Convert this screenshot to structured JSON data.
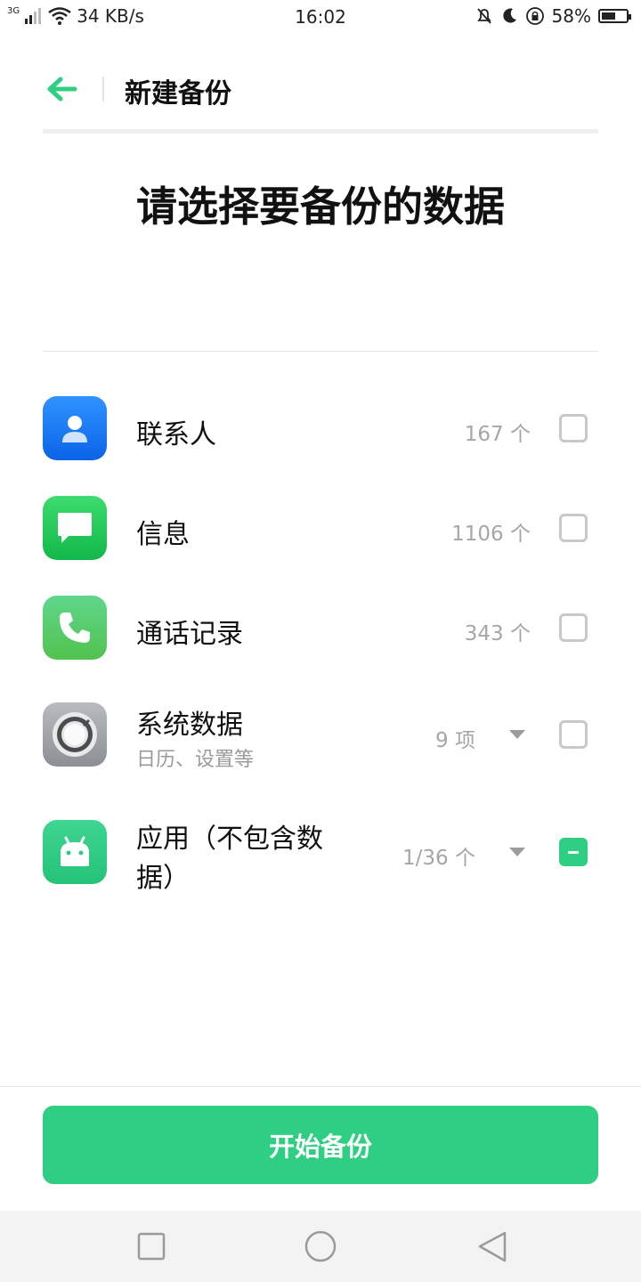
{
  "status_bar": {
    "network": "3G",
    "speed": "34 KB/s",
    "time": "16:02",
    "battery": "58%",
    "battery_level": 0.58
  },
  "header": {
    "title": "新建备份"
  },
  "page_title": "请选择要备份的数据",
  "items": [
    {
      "label": "联系人",
      "sub": "",
      "count": "167 个",
      "has_arrow": false,
      "state": "unchecked",
      "icon": "contact-icon"
    },
    {
      "label": "信息",
      "sub": "",
      "count": "1106 个",
      "has_arrow": false,
      "state": "unchecked",
      "icon": "message-icon"
    },
    {
      "label": "通话记录",
      "sub": "",
      "count": "343 个",
      "has_arrow": false,
      "state": "unchecked",
      "icon": "phone-icon"
    },
    {
      "label": "系统数据",
      "sub": "日历、设置等",
      "count": "9 项",
      "has_arrow": true,
      "state": "unchecked",
      "icon": "settings-icon"
    },
    {
      "label": "应用（不包含数",
      "label2": "据）",
      "sub": "",
      "count": "1/36 个",
      "has_arrow": true,
      "state": "partial",
      "icon": "android-icon"
    }
  ],
  "start_button": "开始备份",
  "colors": {
    "accent": "#2ecf82",
    "contact_icon_bg": "#1a7cf5",
    "message_icon_bg": "#22c85a",
    "phone_icon_bg": "#5fd075",
    "settings_icon_bg": "#9ea2a8",
    "android_icon_bg": "#2fcc85"
  }
}
